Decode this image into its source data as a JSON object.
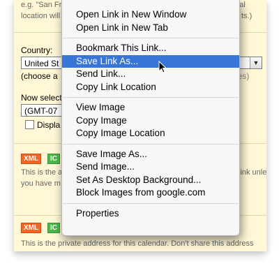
{
  "background": {
    "hint_line1": "e.g. \"San Francisco\" or \"New York\" or \"USA.\" Specifying a general",
    "hint_line2_left": "location will",
    "hint_line2_right": "ts.)",
    "country_label": "Country:",
    "country_value": "United St",
    "choose_left": "(choose a",
    "choose_right": "ll timezones)",
    "select_tz_left": "Now select",
    "timezone_value": "(GMT-07",
    "display_left": "Displa",
    "badges": {
      "xml": "XML",
      "ical": "IC"
    },
    "private_line1_left": "This is the a",
    "private_line1_right": "link unless",
    "private_line2_left": "you have m",
    "private_bottom": "This is the private address for this calendar. Don't share this address"
  },
  "context_menu": {
    "groups": [
      [
        {
          "label": "Open Link in New Window"
        },
        {
          "label": "Open Link in New Tab"
        }
      ],
      [
        {
          "label": "Bookmark This Link..."
        },
        {
          "label": "Save Link As...",
          "selected": true
        },
        {
          "label": "Send Link..."
        },
        {
          "label": "Copy Link Location"
        }
      ],
      [
        {
          "label": "View Image"
        },
        {
          "label": "Copy Image"
        },
        {
          "label": "Copy Image Location"
        }
      ],
      [
        {
          "label": "Save Image As..."
        },
        {
          "label": "Send Image..."
        },
        {
          "label": "Set As Desktop Background..."
        },
        {
          "label": "Block Images from google.com"
        }
      ],
      [
        {
          "label": "Properties"
        }
      ]
    ]
  },
  "colors": {
    "page_bg": "#fff7d6",
    "menu_bg": "#f7f7f7",
    "selection": "#3875d7",
    "xml_badge": "#f26522",
    "ical_badge": "#4cb848"
  }
}
